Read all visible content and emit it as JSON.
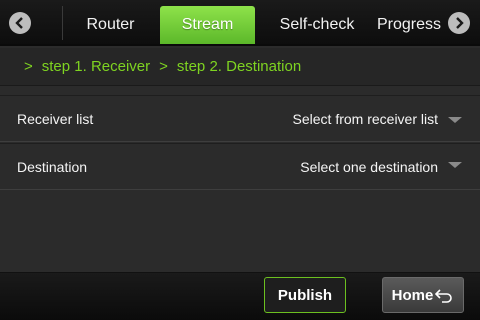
{
  "tabs": {
    "prev_icon": "chevron-left-icon",
    "next_icon": "chevron-right-icon",
    "router": "Router",
    "stream": "Stream",
    "selfcheck": "Self-check",
    "progress": "Progress",
    "active": "Stream",
    "active_color": "#6cc62f"
  },
  "breadcrumb": {
    "sep1": ">",
    "step1": "step 1. Receiver",
    "sep2": ">",
    "step2": "step 2. Destination",
    "color": "#7ed321"
  },
  "rows": {
    "receiver": {
      "label": "Receiver list",
      "value": "Select from receiver list"
    },
    "destination": {
      "label": "Destination",
      "value": "Select one destination"
    }
  },
  "footer": {
    "publish": "Publish",
    "home": "Home",
    "home_icon": "return-arrow-icon"
  }
}
